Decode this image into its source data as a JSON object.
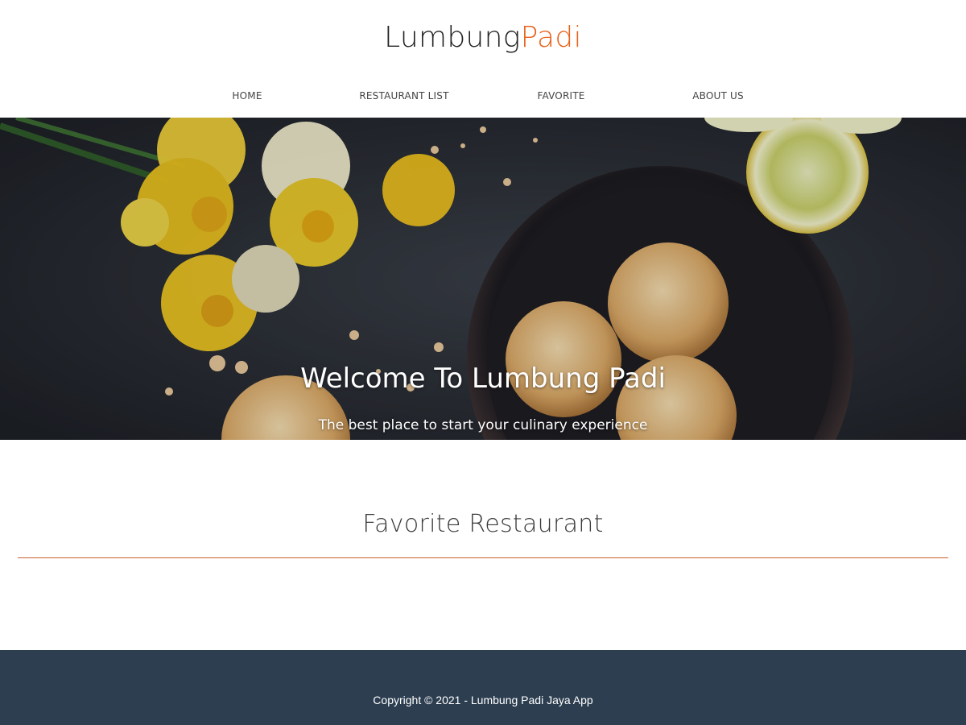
{
  "header": {
    "brand_part1": "Lumbung",
    "brand_part2": "Padi",
    "nav": [
      {
        "label": "HOME"
      },
      {
        "label": "RESTAURANT LIST"
      },
      {
        "label": "FAVORITE"
      },
      {
        "label": "ABOUT US"
      }
    ]
  },
  "hero": {
    "title": "Welcome To Lumbung Padi",
    "subtitle": "The best place to start your culinary experience"
  },
  "main": {
    "section_title": "Favorite Restaurant"
  },
  "footer": {
    "copyright": "Copyright © 2021 - Lumbung Padi Jaya App"
  },
  "colors": {
    "brand_accent": "#e8641e",
    "footer_bg": "#2c3e50",
    "divider": "#c8602a"
  }
}
